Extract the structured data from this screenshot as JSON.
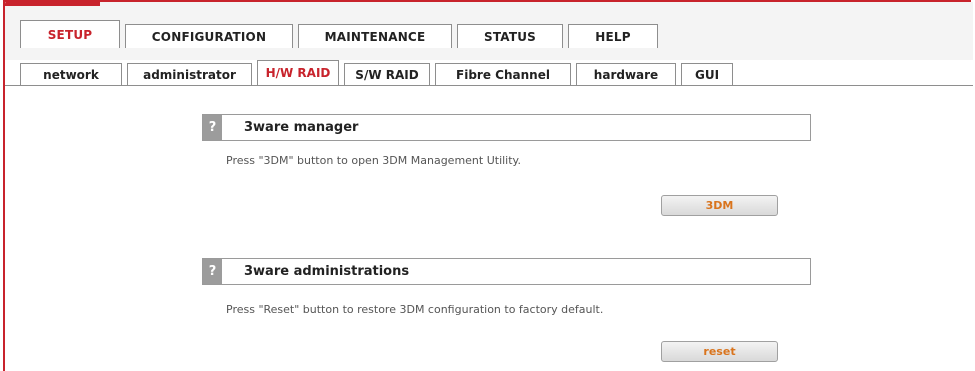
{
  "main_tabs": [
    {
      "label": "SETUP",
      "active": true
    },
    {
      "label": "CONFIGURATION"
    },
    {
      "label": "MAINTENANCE"
    },
    {
      "label": "STATUS"
    },
    {
      "label": "HELP"
    }
  ],
  "sub_tabs": [
    {
      "label": "network"
    },
    {
      "label": "administrator"
    },
    {
      "label": "H/W RAID",
      "active": true
    },
    {
      "label": "S/W RAID"
    },
    {
      "label": "Fibre Channel"
    },
    {
      "label": "hardware"
    },
    {
      "label": "GUI"
    }
  ],
  "sections": [
    {
      "help_glyph": "?",
      "title": "3ware manager",
      "description": "Press \"3DM\" button to open 3DM Management Utility.",
      "button_label": "3DM"
    },
    {
      "help_glyph": "?",
      "title": "3ware administrations",
      "description": "Press \"Reset\" button to restore 3DM configuration to factory default.",
      "button_label": "reset"
    }
  ],
  "colors": {
    "accent": "#c8232c",
    "button_text": "#d9741d",
    "help_bg": "#9c9c9c"
  },
  "icons": {
    "help": "help-icon"
  }
}
